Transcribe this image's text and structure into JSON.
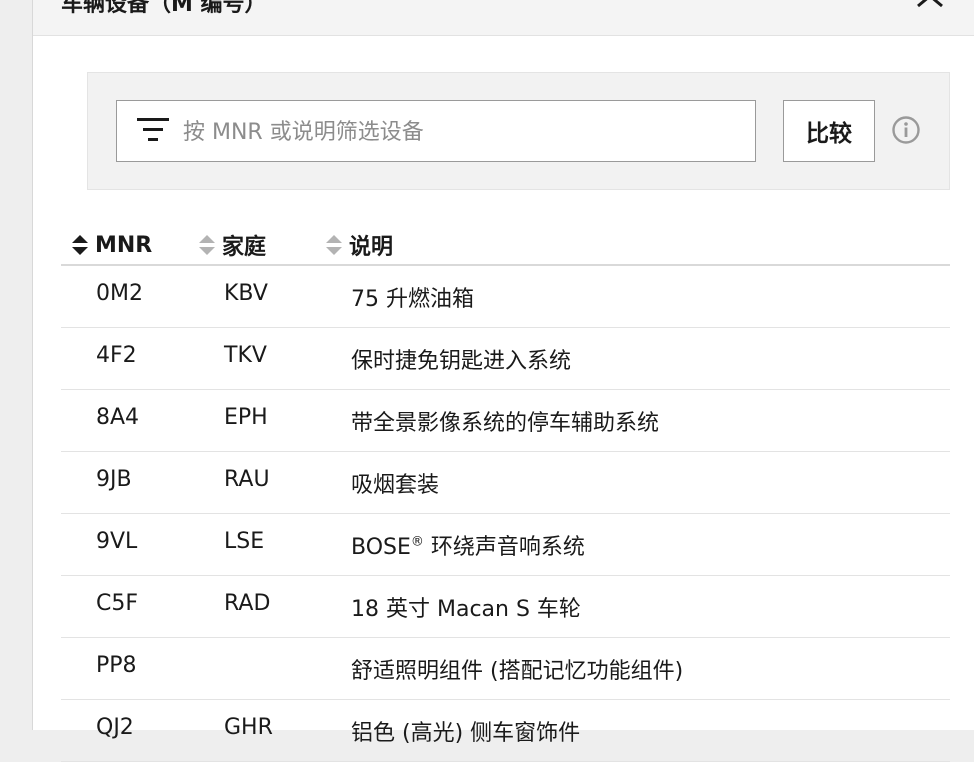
{
  "modal": {
    "title": "车辆设备（M 编号）"
  },
  "filter": {
    "placeholder": "按 MNR 或说明筛选设备",
    "value": "",
    "compare_label": "比较"
  },
  "table": {
    "columns": [
      {
        "key": "mnr",
        "label": "MNR"
      },
      {
        "key": "family",
        "label": "家庭"
      },
      {
        "key": "desc",
        "label": "说明"
      }
    ],
    "rows": [
      {
        "mnr": "0M2",
        "family": "KBV",
        "desc": "75 升燃油箱",
        "desc_sup": ""
      },
      {
        "mnr": "4F2",
        "family": "TKV",
        "desc": "保时捷免钥匙进入系统",
        "desc_sup": ""
      },
      {
        "mnr": "8A4",
        "family": "EPH",
        "desc": "带全景影像系统的停车辅助系统",
        "desc_sup": ""
      },
      {
        "mnr": "9JB",
        "family": "RAU",
        "desc": "吸烟套装",
        "desc_sup": ""
      },
      {
        "mnr": "9VL",
        "family": "LSE",
        "desc": "BOSE",
        "desc_sup": "®",
        "desc_rest": " 环绕声音响系统"
      },
      {
        "mnr": "C5F",
        "family": "RAD",
        "desc": "18 英寸 Macan S 车轮",
        "desc_sup": ""
      },
      {
        "mnr": "PP8",
        "family": "",
        "desc": "舒适照明组件 (搭配记忆功能组件)",
        "desc_sup": ""
      },
      {
        "mnr": "QJ2",
        "family": "GHR",
        "desc": "铝色 (高光) 侧车窗饰件",
        "desc_sup": ""
      }
    ]
  },
  "colors": {
    "panel_bg": "#f2f2f2",
    "border": "#9a9a9a",
    "text": "#1a1a1a",
    "placeholder": "#8c8c8c"
  }
}
